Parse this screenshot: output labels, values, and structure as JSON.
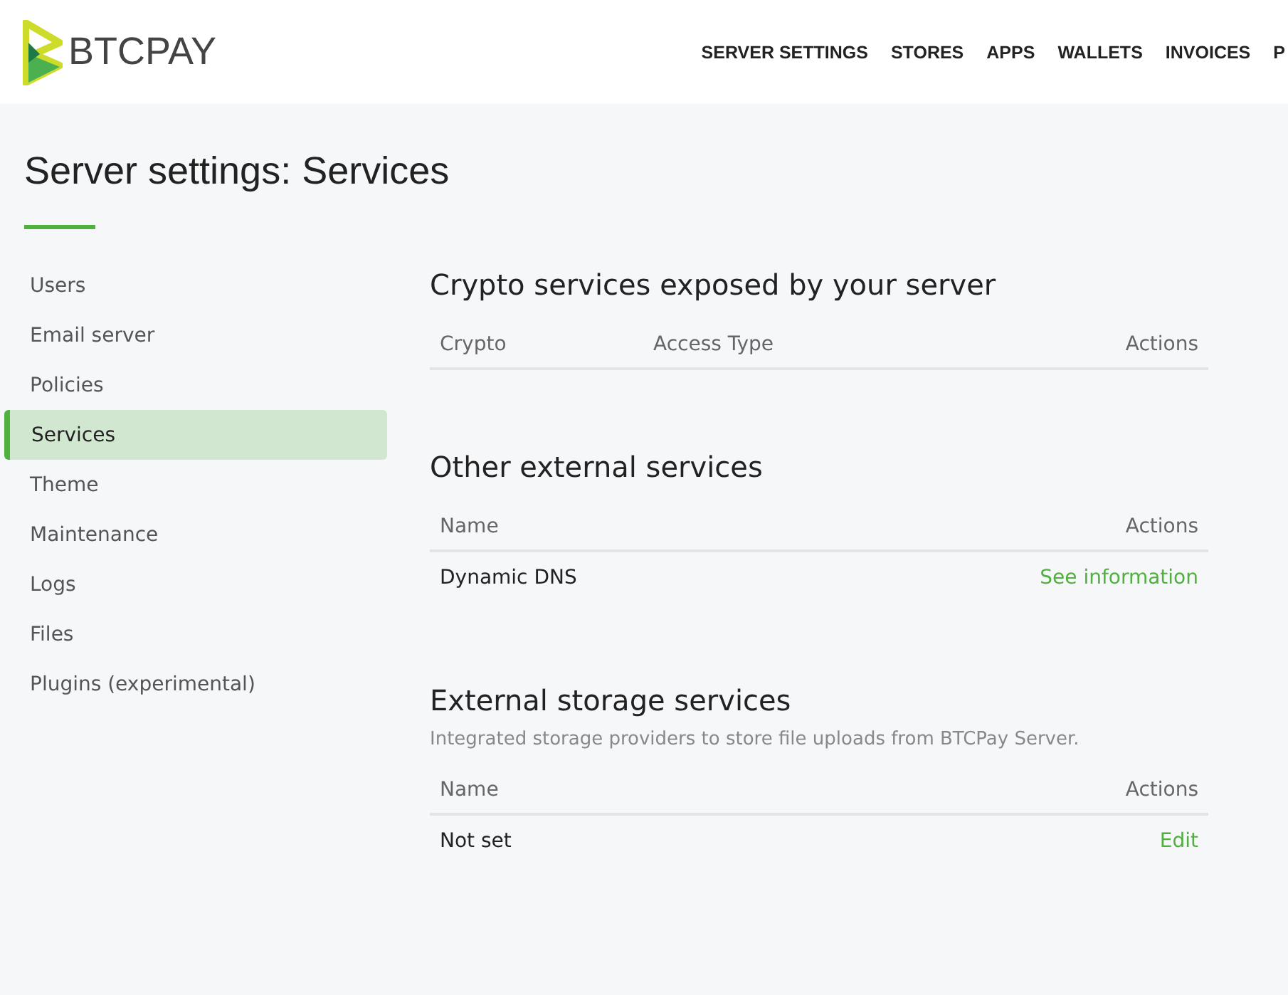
{
  "header": {
    "logo_text": "BTCPAY",
    "nav": [
      {
        "label": "SERVER SETTINGS"
      },
      {
        "label": "STORES"
      },
      {
        "label": "APPS"
      },
      {
        "label": "WALLETS"
      },
      {
        "label": "INVOICES"
      },
      {
        "label": "P"
      }
    ]
  },
  "page_title": "Server settings: Services",
  "sidebar": {
    "items": [
      {
        "label": "Users",
        "selected": false
      },
      {
        "label": "Email server",
        "selected": false
      },
      {
        "label": "Policies",
        "selected": false
      },
      {
        "label": "Services",
        "selected": true
      },
      {
        "label": "Theme",
        "selected": false
      },
      {
        "label": "Maintenance",
        "selected": false
      },
      {
        "label": "Logs",
        "selected": false
      },
      {
        "label": "Files",
        "selected": false
      },
      {
        "label": "Plugins (experimental)",
        "selected": false
      }
    ]
  },
  "sections": [
    {
      "title": "Crypto services exposed by your server",
      "columns": [
        "Crypto",
        "Access Type",
        "Actions"
      ]
    },
    {
      "title": "Other external services",
      "columns": [
        "Name",
        "Actions"
      ],
      "rows": [
        {
          "name": "Dynamic DNS",
          "action": "See information"
        }
      ]
    },
    {
      "title": "External storage services",
      "description": "Integrated storage providers to store file uploads from BTCPay Server.",
      "columns": [
        "Name",
        "Actions"
      ],
      "rows": [
        {
          "name": "Not set",
          "action": "Edit"
        }
      ]
    }
  ]
}
